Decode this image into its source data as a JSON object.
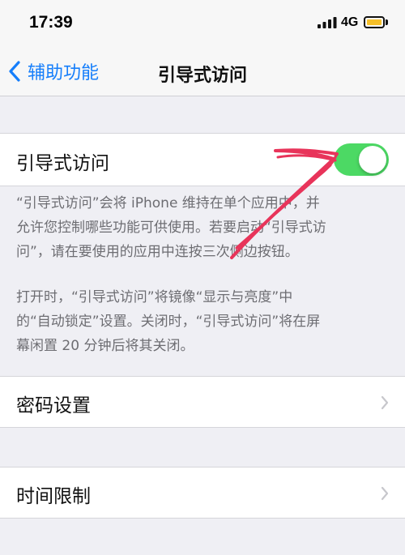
{
  "status_bar": {
    "time": "17:39",
    "network": "4G",
    "battery_color": "#f6c02a"
  },
  "nav": {
    "back_label": "辅助功能",
    "title": "引导式访问"
  },
  "guided_access": {
    "label": "引导式访问",
    "toggle_on": true,
    "toggle_color": "#4cd964"
  },
  "footer": {
    "paragraph_1_line_1": "“引导式访问”会将 iPhone 维持在单个应用中，并",
    "paragraph_1_line_2": "允许您控制哪些功能可供使用。若要启动“引导式访",
    "paragraph_1_line_3": "问”，请在要使用的应用中连按三次侧边按钮。",
    "paragraph_2_line_1": "打开时，“引导式访问”将镜像“显示与亮度”中",
    "paragraph_2_line_2": "的“自动锁定”设置。关闭时，“引导式访问”将在屏",
    "paragraph_2_line_3": "幕闲置 20 分钟后将其关闭。"
  },
  "passcode": {
    "label": "密码设置"
  },
  "time_limits": {
    "label": "时间限制"
  },
  "accent_color": "#157efb",
  "annotation_color": "#e8345a"
}
